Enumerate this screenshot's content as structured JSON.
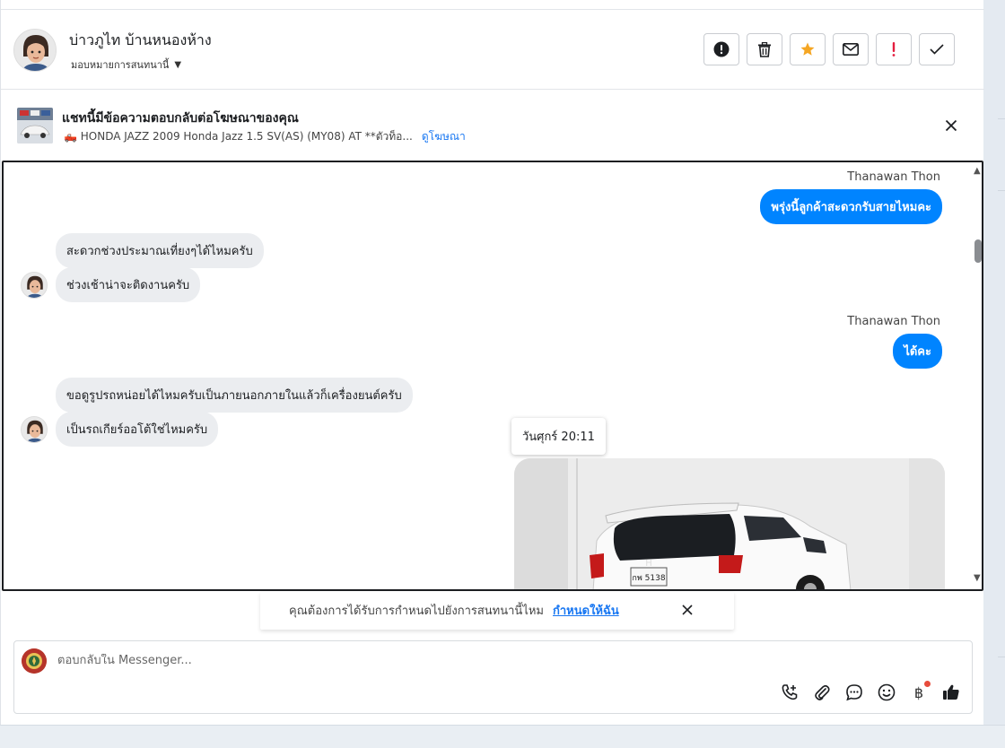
{
  "header": {
    "contact_name": "บ่าวภูไท บ้านหนองห้าง",
    "assign_label": "มอบหมายการสนทนานี้",
    "actions": [
      {
        "name": "mark-spam-button",
        "icon": "alert-circle-icon"
      },
      {
        "name": "delete-button",
        "icon": "trash-icon"
      },
      {
        "name": "star-button",
        "icon": "star-icon"
      },
      {
        "name": "mark-unread-button",
        "icon": "envelope-icon"
      },
      {
        "name": "follow-up-button",
        "icon": "exclamation-icon"
      },
      {
        "name": "done-button",
        "icon": "check-icon"
      }
    ]
  },
  "ad": {
    "title": "แชทนี้มีข้อความตอบกลับต่อโฆษณาของคุณ",
    "subtitle": "🛻 HONDA JAZZ 2009 Honda Jazz 1.5 SV(AS) (MY08) AT **ตัวท็อ...",
    "link": "ดูโฆษณา"
  },
  "messages": {
    "sender1": "Thanawan Thon",
    "out1": "พรุ่งนี้ลูกค้าสะดวกรับสายไหมคะ",
    "in1": "สะดวกช่วงประมาณเที่ยงๆได้ไหมครับ",
    "in2": "ช่วงเช้าน่าจะติดงานครับ",
    "sender2": "Thanawan Thon",
    "out2": "ได้คะ",
    "in3": "ขอดูรูปรถหน่อยได้ไหมครับเป็นภายนอกภายในแล้วก็เครื่องยนต์ครับ",
    "in4": "เป็นรถเกียร์ออโต้ใช่ไหมครับ",
    "timestamp": "วันศุกร์ 20:11",
    "plate": "กพ 5138"
  },
  "prompt": {
    "text": "คุณต้องการได้รับการกำหนดไปยังการสนทนานี้ไหม",
    "link": "กำหนดให้ฉัน"
  },
  "composer": {
    "placeholder": "ตอบกลับใน Messenger..."
  },
  "colors": {
    "accent": "#0084ff",
    "link": "#1877f2",
    "star": "#f5a623",
    "alert": "#e41e3f"
  }
}
